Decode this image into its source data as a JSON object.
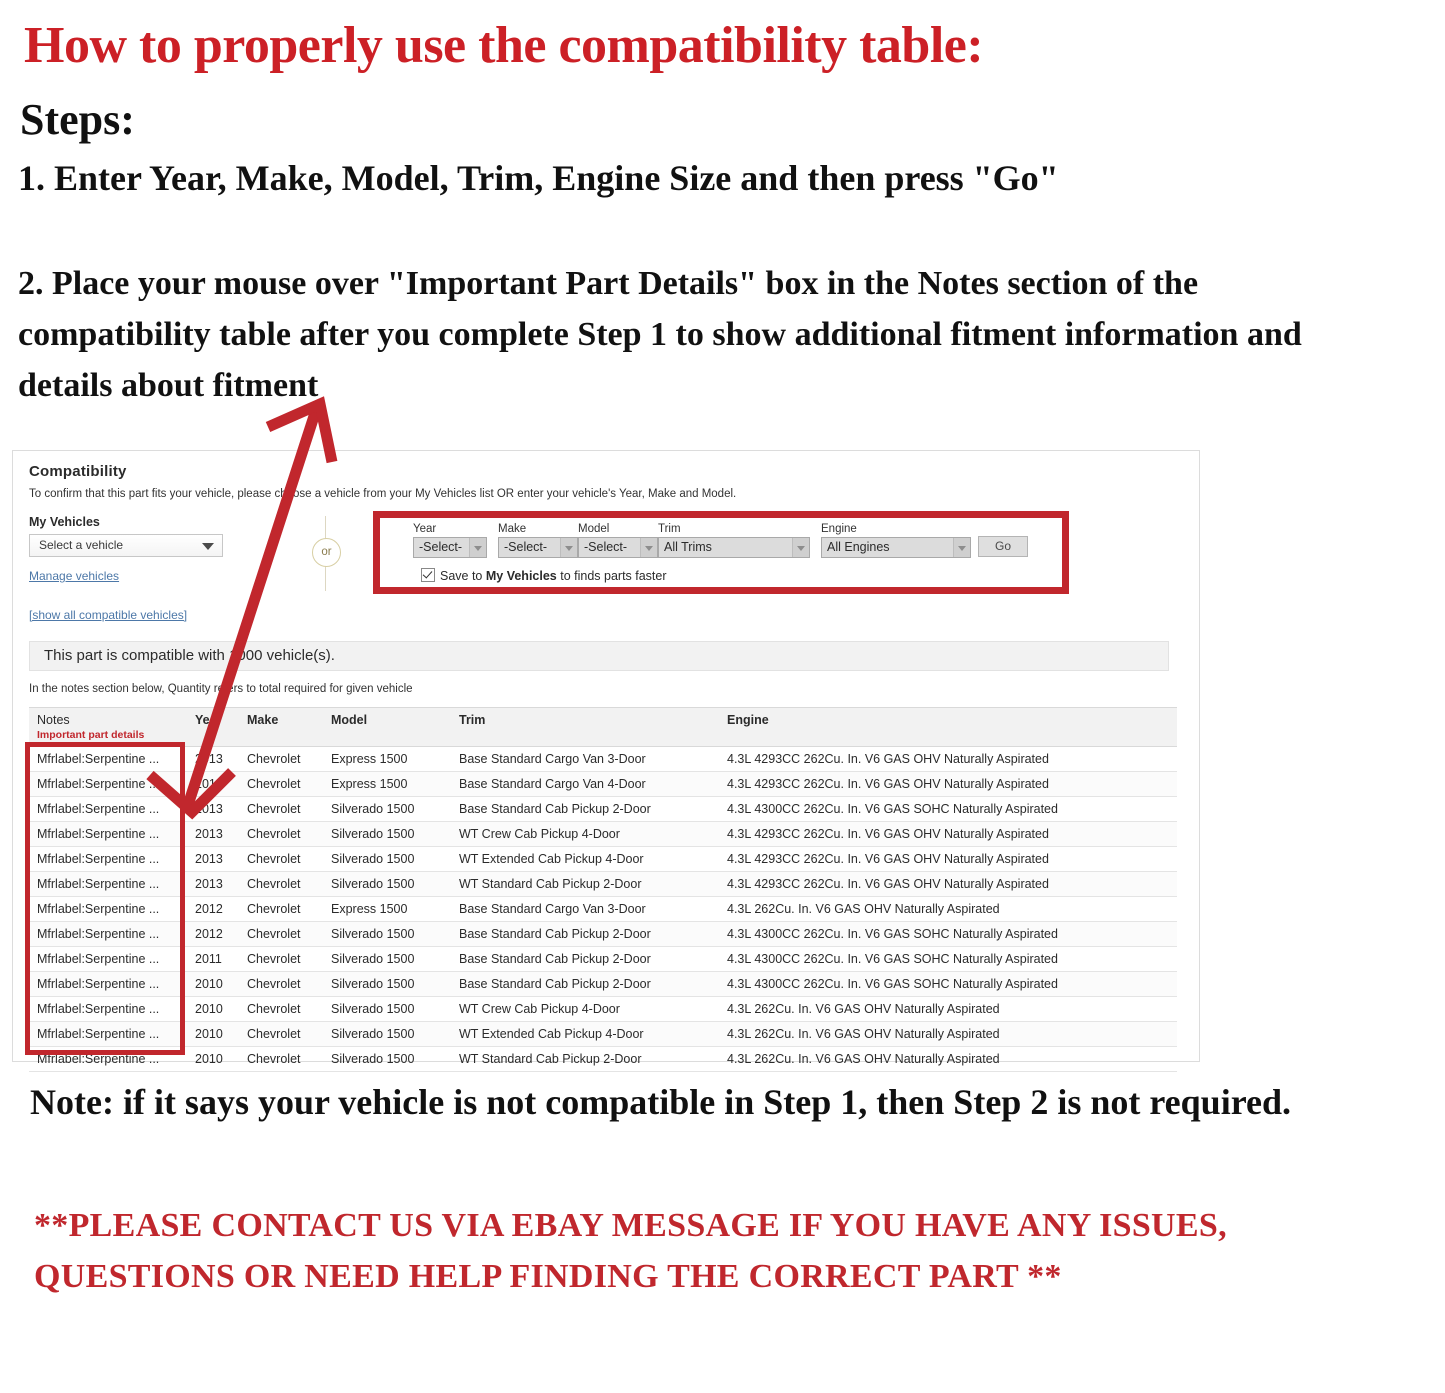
{
  "instructions": {
    "headline": "How to properly use the compatibility table:",
    "steps_label": "Steps:",
    "step1": "1. Enter Year, Make, Model, Trim, Engine Size and then press \"Go\"",
    "step2": "2. Place your mouse over \"Important Part Details\" box in the Notes section of the compatibility table after you complete Step 1 to show additional fitment information and details about fitment",
    "note": "Note: if it says your vehicle is not compatible in Step 1, then Step 2 is not required.",
    "contact": "**PLEASE CONTACT US VIA EBAY MESSAGE IF YOU HAVE ANY ISSUES, QUESTIONS OR NEED HELP FINDING THE CORRECT PART **"
  },
  "colors": {
    "headline_red": "#cc2026",
    "highlight_red": "#c1272d",
    "link_blue": "#4d78a8",
    "contact_red": "#c0272d"
  },
  "panel": {
    "title": "Compatibility",
    "subtitle": "To confirm that this part fits your vehicle, please choose a vehicle from your My Vehicles list OR enter your vehicle's Year, Make and Model.",
    "my_vehicles_label": "My Vehicles",
    "vehicle_select_value": "Select a vehicle",
    "manage_link": "Manage vehicles",
    "show_all_link": "[show all compatible vehicles]",
    "or_label": "or",
    "compat_banner": "This part is compatible with 1000 vehicle(s).",
    "qty_note": "In the notes section below, Quantity refers to total required for given vehicle"
  },
  "form": {
    "fields": [
      {
        "label": "Year",
        "value": "-Select-"
      },
      {
        "label": "Make",
        "value": "-Select-"
      },
      {
        "label": "Model",
        "value": "-Select-"
      },
      {
        "label": "Trim",
        "value": "All Trims"
      },
      {
        "label": "Engine",
        "value": "All Engines"
      }
    ],
    "go_label": "Go",
    "save_prefix": "Save to ",
    "save_bold": "My Vehicles",
    "save_suffix": " to finds parts faster",
    "save_checked": true
  },
  "table": {
    "headers": {
      "notes": "Notes",
      "notes_sub": "Important part details",
      "year": "Year",
      "make": "Make",
      "model": "Model",
      "trim": "Trim",
      "engine": "Engine"
    },
    "rows": [
      {
        "notes": "Mfrlabel:Serpentine ...",
        "year": "2013",
        "make": "Chevrolet",
        "model": "Express 1500",
        "trim": "Base Standard Cargo Van 3-Door",
        "engine": "4.3L 4293CC 262Cu. In. V6 GAS OHV Naturally Aspirated"
      },
      {
        "notes": "Mfrlabel:Serpentine ...",
        "year": "2013",
        "make": "Chevrolet",
        "model": "Express 1500",
        "trim": "Base Standard Cargo Van 4-Door",
        "engine": "4.3L 4293CC 262Cu. In. V6 GAS OHV Naturally Aspirated"
      },
      {
        "notes": "Mfrlabel:Serpentine ...",
        "year": "2013",
        "make": "Chevrolet",
        "model": "Silverado 1500",
        "trim": "Base Standard Cab Pickup 2-Door",
        "engine": "4.3L 4300CC 262Cu. In. V6 GAS SOHC Naturally Aspirated"
      },
      {
        "notes": "Mfrlabel:Serpentine ...",
        "year": "2013",
        "make": "Chevrolet",
        "model": "Silverado 1500",
        "trim": "WT Crew Cab Pickup 4-Door",
        "engine": "4.3L 4293CC 262Cu. In. V6 GAS OHV Naturally Aspirated"
      },
      {
        "notes": "Mfrlabel:Serpentine ...",
        "year": "2013",
        "make": "Chevrolet",
        "model": "Silverado 1500",
        "trim": "WT Extended Cab Pickup 4-Door",
        "engine": "4.3L 4293CC 262Cu. In. V6 GAS OHV Naturally Aspirated"
      },
      {
        "notes": "Mfrlabel:Serpentine ...",
        "year": "2013",
        "make": "Chevrolet",
        "model": "Silverado 1500",
        "trim": "WT Standard Cab Pickup 2-Door",
        "engine": "4.3L 4293CC 262Cu. In. V6 GAS OHV Naturally Aspirated"
      },
      {
        "notes": "Mfrlabel:Serpentine ...",
        "year": "2012",
        "make": "Chevrolet",
        "model": "Express 1500",
        "trim": "Base Standard Cargo Van 3-Door",
        "engine": "4.3L 262Cu. In. V6 GAS OHV Naturally Aspirated"
      },
      {
        "notes": "Mfrlabel:Serpentine ...",
        "year": "2012",
        "make": "Chevrolet",
        "model": "Silverado 1500",
        "trim": "Base Standard Cab Pickup 2-Door",
        "engine": "4.3L 4300CC 262Cu. In. V6 GAS SOHC Naturally Aspirated"
      },
      {
        "notes": "Mfrlabel:Serpentine ...",
        "year": "2011",
        "make": "Chevrolet",
        "model": "Silverado 1500",
        "trim": "Base Standard Cab Pickup 2-Door",
        "engine": "4.3L 4300CC 262Cu. In. V6 GAS SOHC Naturally Aspirated"
      },
      {
        "notes": "Mfrlabel:Serpentine ...",
        "year": "2010",
        "make": "Chevrolet",
        "model": "Silverado 1500",
        "trim": "Base Standard Cab Pickup 2-Door",
        "engine": "4.3L 4300CC 262Cu. In. V6 GAS SOHC Naturally Aspirated"
      },
      {
        "notes": "Mfrlabel:Serpentine ...",
        "year": "2010",
        "make": "Chevrolet",
        "model": "Silverado 1500",
        "trim": "WT Crew Cab Pickup 4-Door",
        "engine": "4.3L 262Cu. In. V6 GAS OHV Naturally Aspirated"
      },
      {
        "notes": "Mfrlabel:Serpentine ...",
        "year": "2010",
        "make": "Chevrolet",
        "model": "Silverado 1500",
        "trim": "WT Extended Cab Pickup 4-Door",
        "engine": "4.3L 262Cu. In. V6 GAS OHV Naturally Aspirated"
      },
      {
        "notes": "Mfrlabel:Serpentine ...",
        "year": "2010",
        "make": "Chevrolet",
        "model": "Silverado 1500",
        "trim": "WT Standard Cab Pickup 2-Door",
        "engine": "4.3L 262Cu. In. V6 GAS OHV Naturally Aspirated"
      }
    ]
  }
}
